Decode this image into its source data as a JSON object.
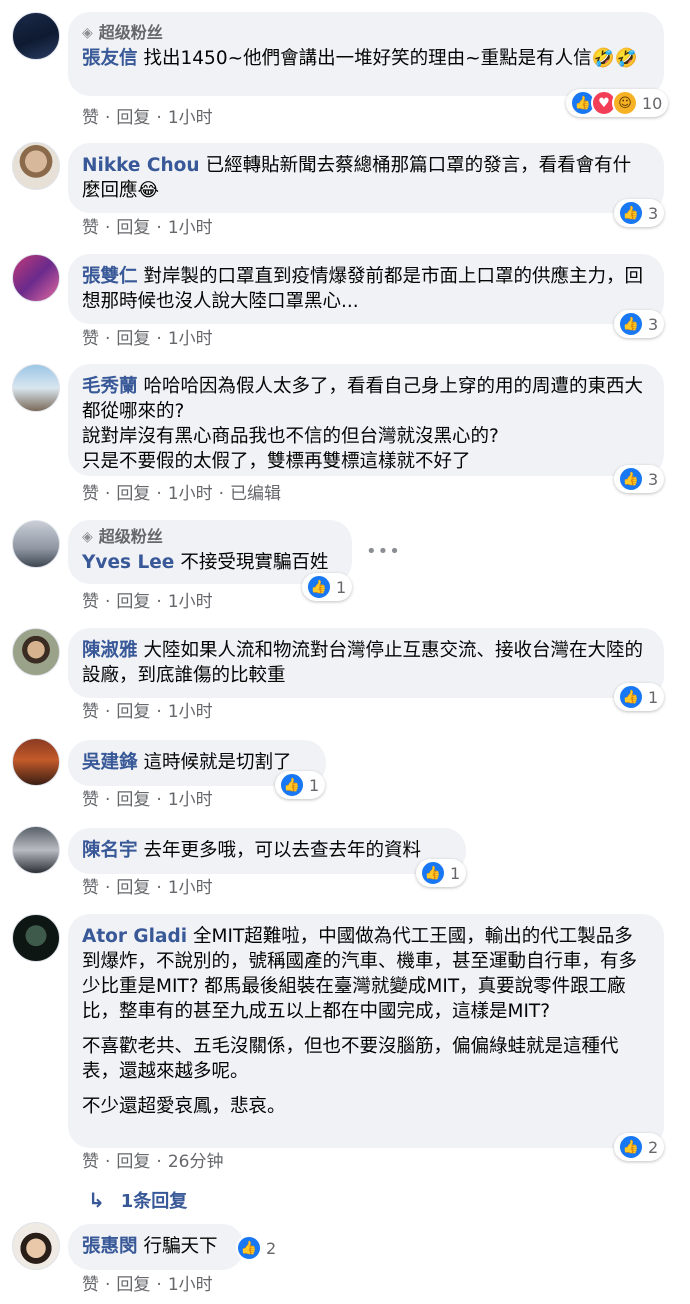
{
  "icons": {
    "super_fan": "diamond-icon",
    "like": "thumbs-up-icon",
    "love": "heart-icon",
    "haha": "laugh-icon",
    "reply_arrow": "reply-arrow-icon",
    "more": "ellipsis-icon"
  },
  "colors": {
    "author": "#385898",
    "bubble": "#f0f2f5",
    "meta": "#65676b",
    "like": "#1877f2",
    "love": "#f33e58",
    "haha": "#f7b125"
  },
  "actions": {
    "like": "赞",
    "reply": "回复",
    "separator": "·"
  },
  "comments": [
    {
      "badge": "超级粉丝",
      "author": "張友信",
      "text": "找出1450~他們會講出一堆好笑的理由~重點是有人信🤣🤣",
      "reaction_count": "10",
      "time": "1小时"
    },
    {
      "author": "Nikke Chou",
      "text": "已經轉貼新聞去蔡總桶那篇口罩的發言，看看會有什麼回應😂",
      "reaction_count": "3",
      "time": "1小时"
    },
    {
      "author": "張雙仁",
      "text": "對岸製的口罩直到疫情爆發前都是市面上口罩的供應主力，回想那時候也沒人說大陸口罩黑心...",
      "reaction_count": "3",
      "time": "1小时"
    },
    {
      "author": "毛秀蘭",
      "text": "哈哈哈因為假人太多了，看看自己身上穿的用的周遭的東西大都從哪來的?",
      "text2": "說對岸沒有黑心商品我也不信的但台灣就沒黑心的?",
      "text3": "只是不要假的太假了，雙標再雙標這樣就不好了",
      "reaction_count": "3",
      "time": "1小时",
      "edited": "已编辑"
    },
    {
      "badge": "超级粉丝",
      "author": "Yves Lee",
      "text": "不接受現實騙百姓",
      "reaction_count": "1",
      "time": "1小时"
    },
    {
      "author": "陳淑雅",
      "text": "大陸如果人流和物流對台灣停止互惠交流、接收台灣在大陸的設廠，到底誰傷的比較重",
      "reaction_count": "1",
      "time": "1小时"
    },
    {
      "author": "吳建鋒",
      "text": "這時候就是切割了",
      "reaction_count": "1",
      "time": "1小时"
    },
    {
      "author": "陳名宇",
      "text": "去年更多哦，可以去查去年的資料",
      "reaction_count": "1",
      "time": "1小时"
    },
    {
      "author": "Ator Gladi",
      "text": "全MIT超難啦，中國做為代工王國，輸出的代工製品多到爆炸，不說別的，號稱國產的汽車、機車，甚至運動自行車，有多少比重是MIT? 都馬最後組裝在臺灣就變成MIT，真要說零件跟工廠比，整車有的甚至九成五以上都在中國完成，這樣是MIT?",
      "text2": "不喜歡老共、五毛沒關係，但也不要沒腦筋，偏偏綠蛙就是這種代表，還越來越多呢。",
      "text3": "不少還超愛哀鳳，悲哀。",
      "reaction_count": "2",
      "time": "26分钟"
    },
    {
      "author": "張惠閔",
      "text": "行騙天下",
      "reaction_count": "2",
      "time": "1小时"
    }
  ],
  "replies_link": "1条回复"
}
